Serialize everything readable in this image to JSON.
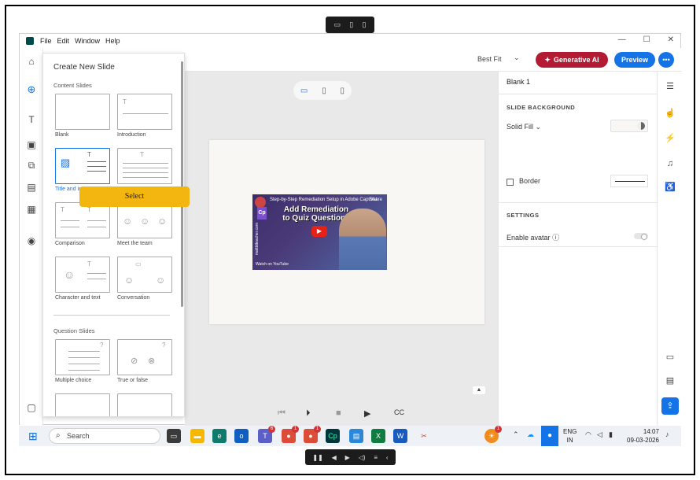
{
  "top_pill": {
    "icons": [
      "monitor-icon",
      "tablet-icon",
      "phone-icon"
    ]
  },
  "menu": {
    "items": [
      "File",
      "Edit",
      "Window",
      "Help"
    ]
  },
  "window_controls": {
    "minimize": "—",
    "maximize": "☐",
    "close": "✕"
  },
  "toolbar": {
    "zoom": "Best Fit",
    "generative_ai": "Generative AI",
    "preview": "Preview",
    "more": "•••"
  },
  "new_slide_panel": {
    "title": "Create New Slide",
    "content_section": "Content Slides",
    "question_section": "Question Slides",
    "content_slides": [
      "Blank",
      "Introduction",
      "Title and image",
      "",
      "Comparison",
      "Meet the team",
      "Character and text",
      "Conversation"
    ],
    "question_slides": [
      "Multiple choice",
      "True or false"
    ],
    "selected": "Title and image"
  },
  "select_button": {
    "label": "Select"
  },
  "video": {
    "top_title": "Step-by-Step Remediation Setup in Adobe Captivat",
    "headline": "Add Remediation to Quiz Questions",
    "side_text": "mattbtteacher.com",
    "watch_on": "Watch on  YouTube",
    "share": "Share",
    "cp": "Cp"
  },
  "right_panel": {
    "title": "Blank 1",
    "slide_background": "SLIDE BACKGROUND",
    "solid_fill": "Solid Fill",
    "border": "Border",
    "settings": "SETTINGS",
    "enable_avatar": "Enable avatar"
  },
  "taskbar": {
    "search_placeholder": "Search",
    "badges": {
      "teams": "6",
      "chrome1": "1",
      "chrome2": "1",
      "tray": "1"
    },
    "lang_top": "ENG",
    "lang_bottom": "IN",
    "time": "14:07",
    "date": "09-03-2026"
  },
  "bottom_pill": {
    "icons": [
      "pause-icon",
      "prev-icon",
      "next-icon",
      "volume-icon",
      "menu-icon",
      "collapse-icon"
    ]
  },
  "colors": {
    "accent_blue": "#1473e6",
    "gen_ai_red": "#b21b33",
    "select_yellow": "#f3b610"
  }
}
